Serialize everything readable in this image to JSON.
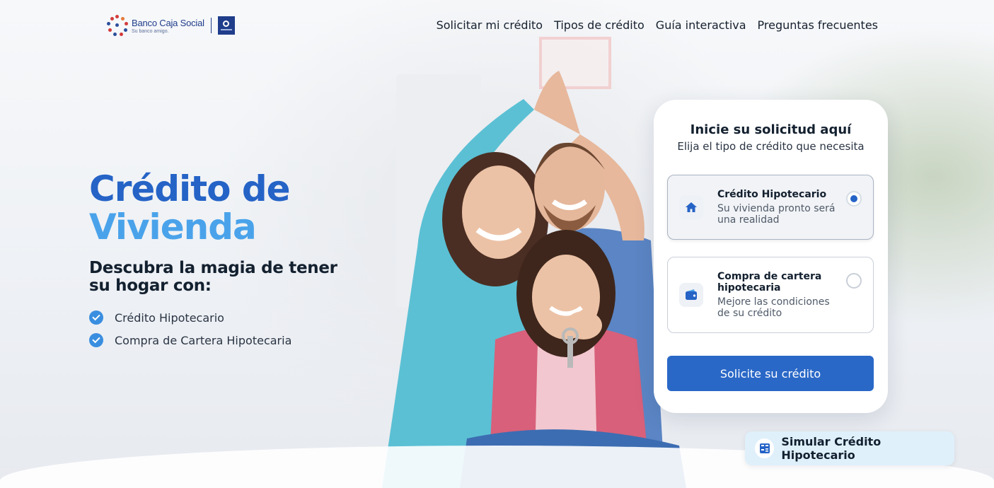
{
  "brand": {
    "name": "Banco Caja Social",
    "tagline": "Su banco amigo."
  },
  "nav": {
    "items": [
      "Solicitar mi crédito",
      "Tipos de crédito",
      "Guía interactiva",
      "Preguntas frecuentes"
    ]
  },
  "hero": {
    "title_line1": "Crédito de",
    "title_line2": "Vivienda",
    "subtitle": "Descubra la magia de tener su hogar con:",
    "features": [
      "Crédito Hipotecario",
      "Compra de Cartera Hipotecaria"
    ]
  },
  "form": {
    "title": "Inicie su solicitud aquí",
    "subtitle": "Elija el tipo de crédito que necesita",
    "options": [
      {
        "title": "Crédito Hipotecario",
        "description": "Su vivienda pronto será una realidad",
        "icon": "house-icon",
        "selected": true
      },
      {
        "title": "Compra de cartera hipotecaria",
        "description": "Mejore las condiciones de su crédito",
        "icon": "wallet-icon",
        "selected": false
      }
    ],
    "submit_label": "Solicite su crédito"
  },
  "simulator": {
    "label": "Simular Crédito Hipotecario",
    "icon": "calculator-icon"
  },
  "colors": {
    "primary": "#2563c6",
    "accent": "#4aa3ea",
    "button": "#2a68c7",
    "simulator_bg": "#dff0fb"
  }
}
